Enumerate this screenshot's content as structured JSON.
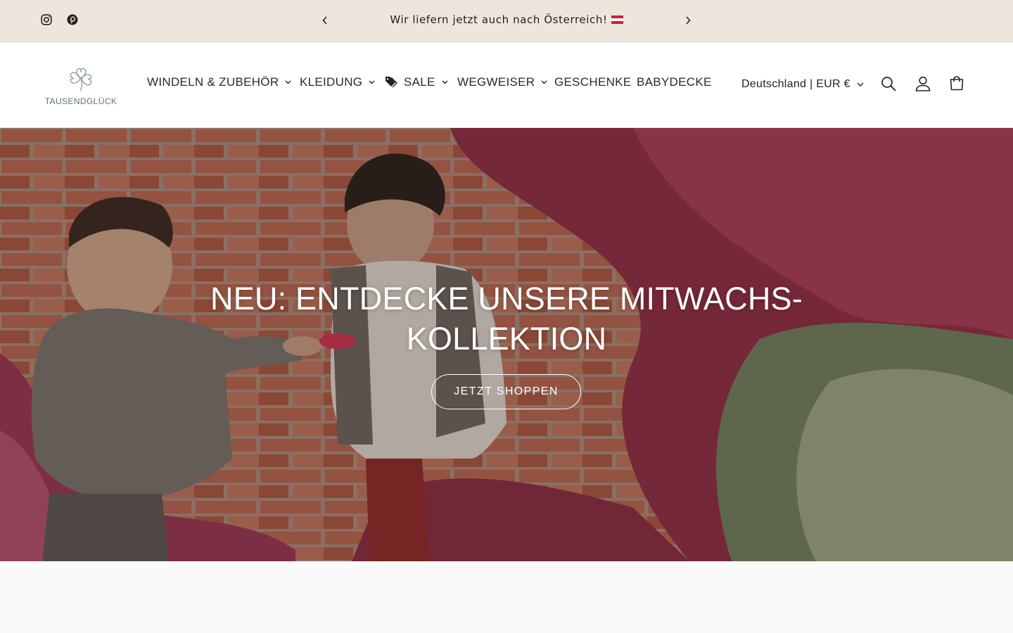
{
  "announcement": {
    "text": "Wir liefern jetzt auch nach Österreich!",
    "flag_icon": "austria-flag-icon",
    "prev_icon": "chevron-left-icon",
    "next_icon": "chevron-right-icon"
  },
  "social": {
    "instagram_icon": "instagram-icon",
    "pinterest_icon": "pinterest-icon"
  },
  "header": {
    "logo_text": "TAUSENDGLÜCK",
    "logo_icon": "clover-icon",
    "nav": [
      {
        "label": "WINDELN & ZUBEHÖR",
        "has_dropdown": true
      },
      {
        "label": "KLEIDUNG",
        "has_dropdown": true
      },
      {
        "label": "SALE",
        "has_dropdown": true,
        "icon": "tag-icon"
      },
      {
        "label": "WEGWEISER",
        "has_dropdown": true
      },
      {
        "label": "GESCHENKE",
        "has_dropdown": false
      },
      {
        "label": "BABYDECKE",
        "has_dropdown": false
      }
    ],
    "country_selector": "Deutschland | EUR €",
    "icons": [
      "search-icon",
      "account-icon",
      "cart-icon"
    ]
  },
  "hero": {
    "title": "NEU: ENTDECKE UNSERE MITWACHS-KOLLEKTION",
    "button_label": "JETZT SHOPPEN"
  },
  "colors": {
    "announcement_bg": "#eee6dc",
    "header_bg": "#ffffff",
    "logo_green": "#5a7a67",
    "hero_text": "#ffffff"
  }
}
